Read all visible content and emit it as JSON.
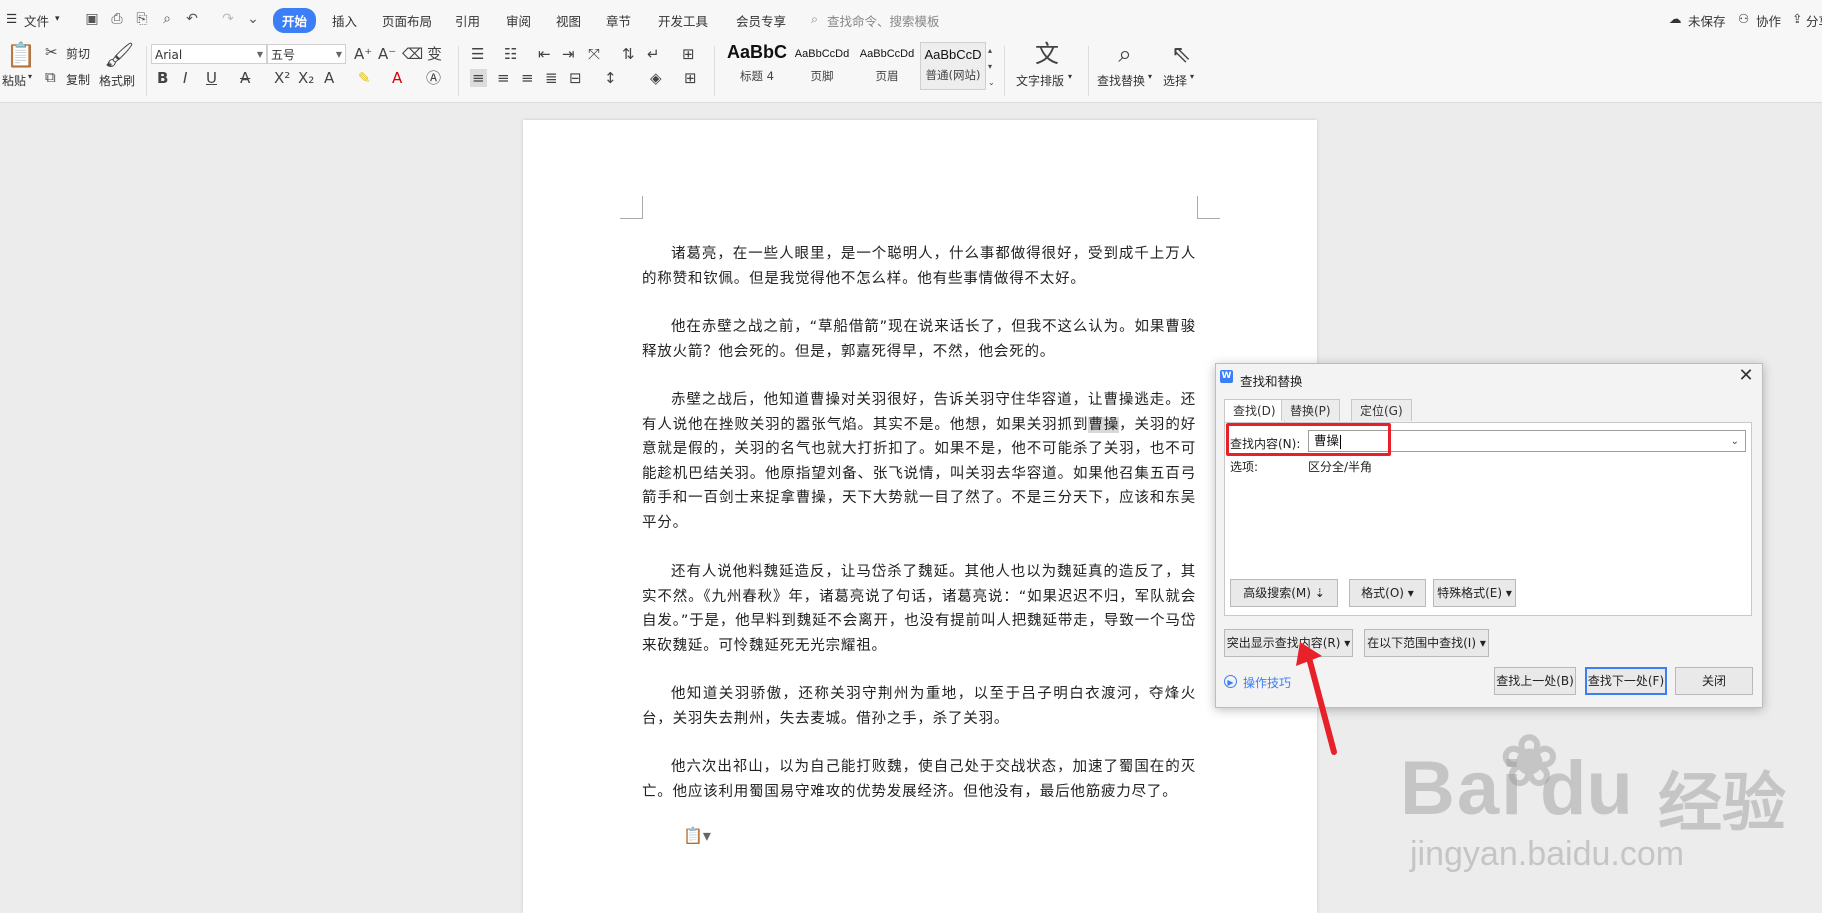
{
  "menubar": {
    "file_label": "文件",
    "tabs": [
      "开始",
      "插入",
      "页面布局",
      "引用",
      "审阅",
      "视图",
      "章节",
      "开发工具",
      "会员专享"
    ],
    "search_placeholder": "查找命令、搜索模板",
    "unsaved_label": "未保存",
    "collab_label": "协作",
    "share_label": "分享"
  },
  "ribbon": {
    "paste_label": "粘贴",
    "cut_label": "剪切",
    "copy_label": "复制",
    "format_painter_label": "格式刷",
    "font_name": "Arial",
    "font_size": "五号",
    "styles": [
      {
        "sample": "AaBbC",
        "name": "标题 4"
      },
      {
        "sample": "AaBbCcDd",
        "name": "页脚"
      },
      {
        "sample": "AaBbCcDd",
        "name": "页眉"
      },
      {
        "sample": "AaBbCcD",
        "name": "普通(网站)"
      }
    ],
    "text_layout_label": "文字排版",
    "find_replace_label": "查找替换",
    "select_label": "选择"
  },
  "document": {
    "paragraphs": [
      {
        "text": "诸葛亮，在一些人眼里，是一个聪明人，什么事都做得很好，受到成千上万人的称赞和钦佩。但是我觉得他不怎么样。他有些事情做得不太好。"
      },
      {
        "text": "他在赤壁之战之前，“草船借箭”现在说来话长了，但我不这么认为。如果曹骏释放火箭？他会死的。但是，郭嘉死得早，不然，他会死的。"
      },
      {
        "before": "赤壁之战后，他知道曹操对关羽很好，告诉关羽守住华容道，让曹操逃走。还有人说他在挫败关羽的嚣张气焰。其实不是。他想，如果关羽抓到",
        "highlight": "曹操",
        "after": "，关羽的好意就是假的，关羽的名气也就大打折扣了。如果不是，他不可能杀了关羽，也不可能趁机巴结关羽。他原指望刘备、张飞说情，叫关羽去华容道。如果他召集五百弓箭手和一百剑士来捉拿曹操，天下大势就一目了然了。不是三分天下，应该和东吴平分。"
      },
      {
        "text": "还有人说他料魏延造反，让马岱杀了魏延。其他人也以为魏延真的造反了，其实不然。《九州春秋》年，诸葛亮说了句话，诸葛亮说：“如果迟迟不归，军队就会自发。”于是，他早料到魏延不会离开，也没有提前叫人把魏延带走，导致一个马岱来砍魏延。可怜魏延死无光宗耀祖。"
      },
      {
        "text": "他知道关羽骄傲，还称关羽守荆州为重地，以至于吕子明白衣渡河，夺烽火台，关羽失去荆州，失去麦城。借孙之手，杀了关羽。"
      },
      {
        "text": "他六次出祁山，以为自己能打败魏，使自己处于交战状态，加速了蜀国在的灭亡。他应该利用蜀国易守难攻的优势发展经济。但他没有，最后他筋疲力尽了。"
      }
    ]
  },
  "dialog": {
    "title": "查找和替换",
    "tabs": [
      "查找(D)",
      "替换(P)",
      "定位(G)"
    ],
    "find_label": "查找内容(N):",
    "find_value": "曹操",
    "options_label": "选项:",
    "options_value": "区分全/半角",
    "advanced_search_label": "高级搜索(M)",
    "format_label": "格式(O)",
    "special_format_label": "特殊格式(E)",
    "highlight_label": "突出显示查找内容(R)",
    "find_in_label": "在以下范围中查找(I)",
    "tips_label": "操作技巧",
    "find_prev_label": "查找上一处(B)",
    "find_next_label": "查找下一处(F)",
    "close_label": "关闭"
  },
  "watermark": {
    "brand": "Bai",
    "brand2": "经验",
    "url": "jingyan.baidu.com"
  },
  "colors": {
    "accent": "#3b7ef6",
    "annotation_red": "#e8202a"
  }
}
